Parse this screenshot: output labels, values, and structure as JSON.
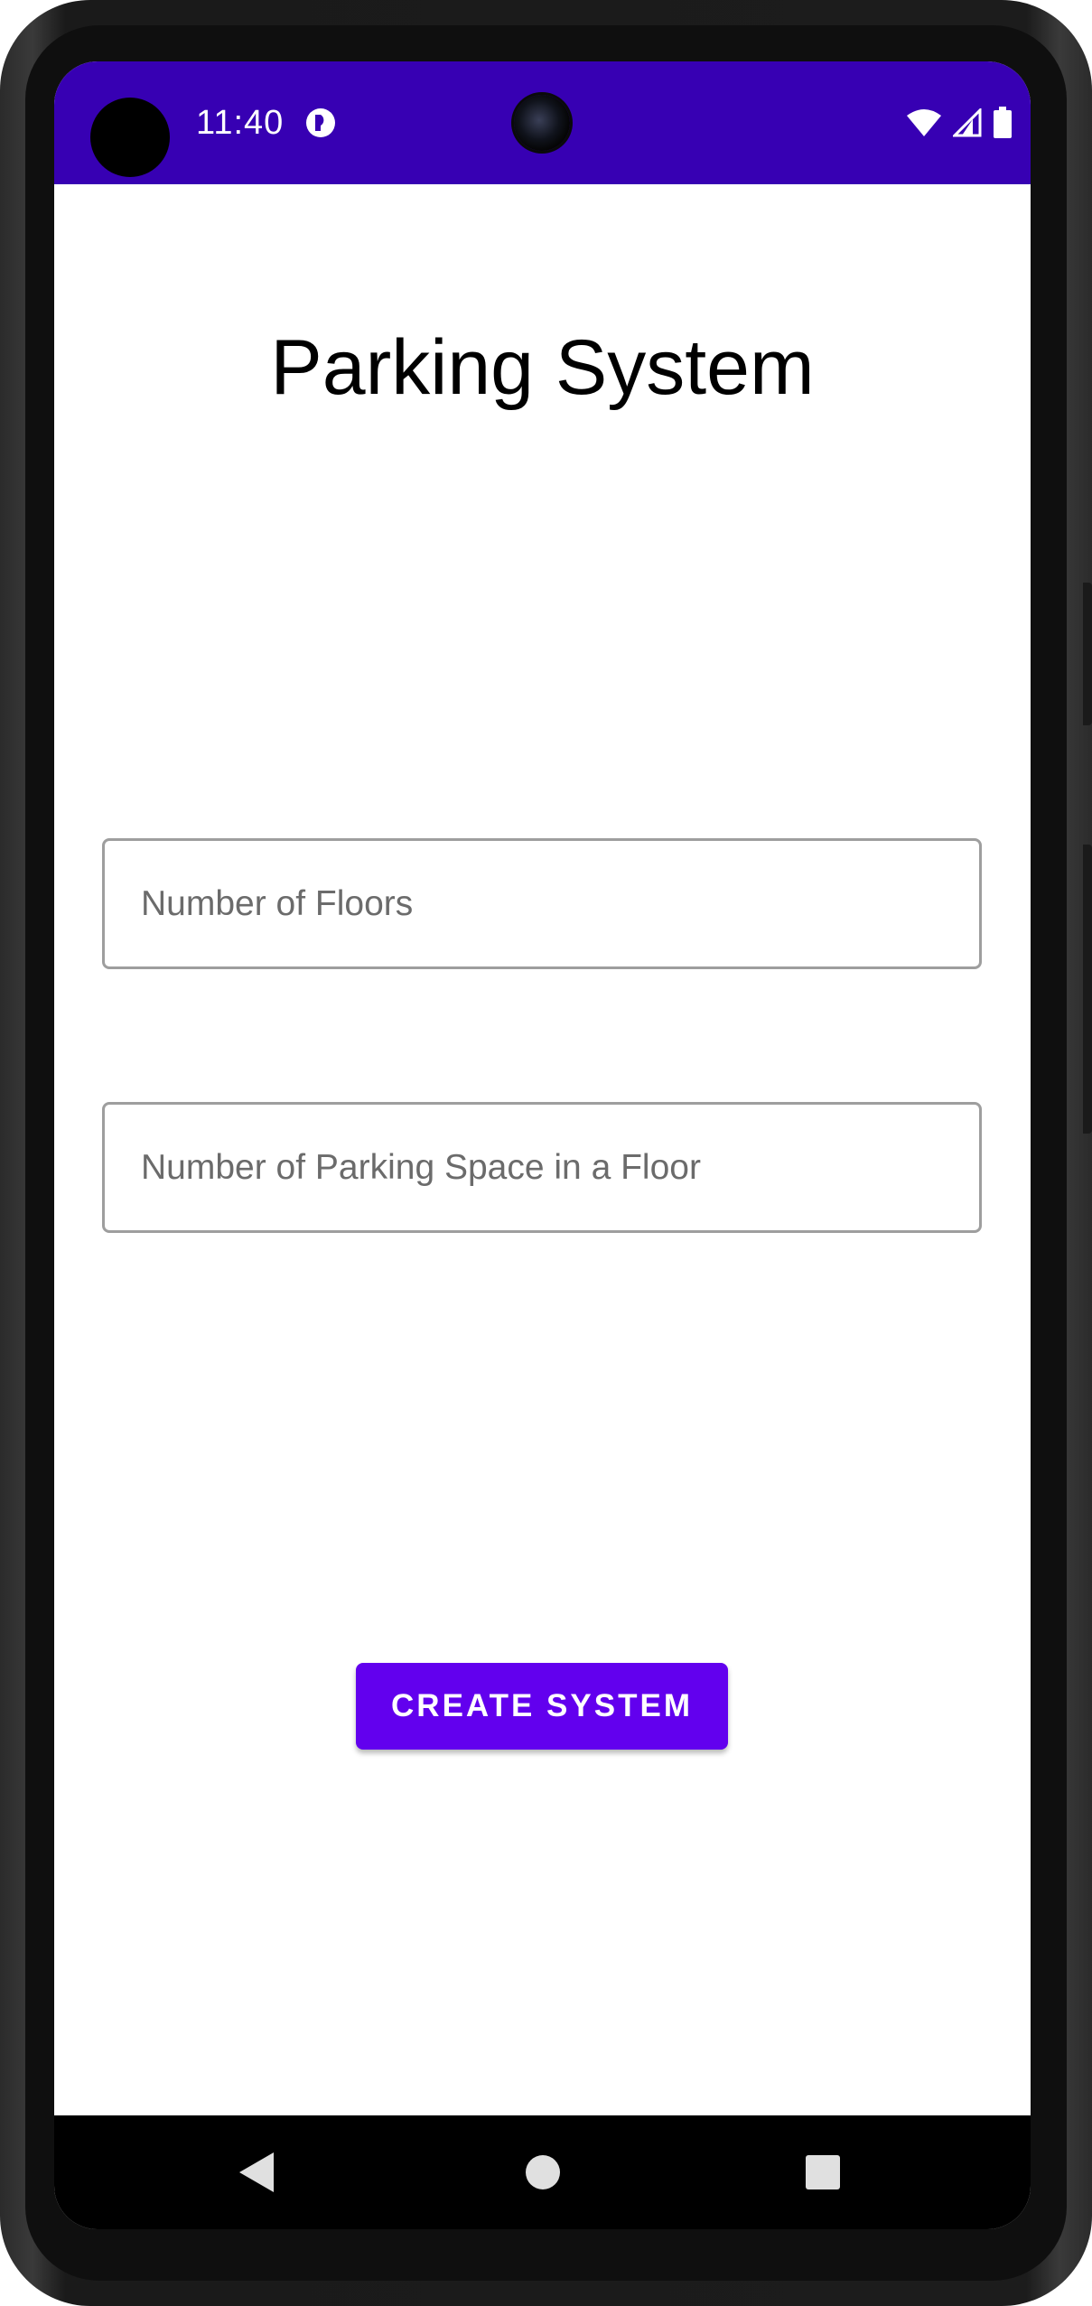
{
  "status_bar": {
    "time": "11:40",
    "color": "#3700b3",
    "icons": [
      "app-notification-icon",
      "wifi-icon",
      "cell-signal-icon",
      "battery-icon"
    ]
  },
  "page": {
    "title": "Parking System"
  },
  "form": {
    "floors_placeholder": "Number of Floors",
    "floors_value": "",
    "spaces_placeholder": "Number of Parking Space in a Floor",
    "spaces_value": "",
    "create_label": "CREATE SYSTEM",
    "accent_color": "#6200ee"
  },
  "nav_bar": {
    "buttons": [
      "back-icon",
      "home-icon",
      "recents-icon"
    ]
  }
}
